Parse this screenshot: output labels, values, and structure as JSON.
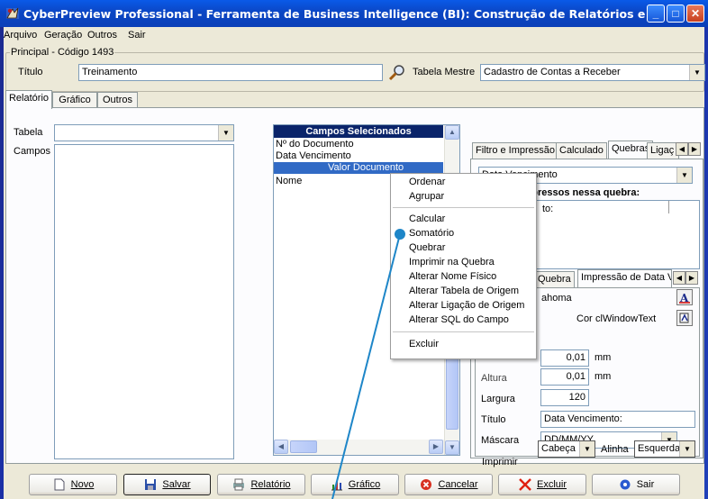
{
  "window": {
    "title": "CyberPreview Professional - Ferramenta de Business Intelligence (BI): Construção de Relatórios e Gráficos Per..."
  },
  "menu": [
    "Arquivo",
    "Geração",
    "Outros",
    "Sair"
  ],
  "principal": {
    "legend": "Principal - Código 1493",
    "titulo_label": "Título",
    "titulo_value": "Treinamento",
    "tabela_mestre_label": "Tabela Mestre",
    "tabela_mestre_value": "Cadastro de Contas a Receber"
  },
  "main_tabs": [
    "Relatório",
    "Gráfico",
    "Outros"
  ],
  "left_panel": {
    "tabela_label": "Tabela",
    "tabela_value": "",
    "campos_label": "Campos"
  },
  "selected_fields": {
    "header": "Campos Selecionados",
    "items": [
      "Nº do Documento",
      "Data Vencimento",
      "Valor Documento",
      "Nome"
    ],
    "selected_index": 2
  },
  "right_tabs": [
    "Filtro e Impressão",
    "Calculado",
    "Quebras",
    "Ligaç"
  ],
  "quebras": {
    "break_field": "Data Vencimento",
    "printed_label": "Campos impressos nessa quebra:",
    "printed_item_partial": "to:",
    "sub_tabs": [
      "Quebra",
      "Impressão de Data Ver"
    ],
    "font_name_partial": "ahoma",
    "cor_label": "Cor",
    "cor_value": "clWindowText",
    "pos_value_1": "0,01",
    "pos_unit_1": "mm",
    "altura_label": "Altura",
    "pos_value_2": "0,01",
    "pos_unit_2": "mm",
    "largura_label": "Largura",
    "largura_value": "120",
    "titulo_label": "Título",
    "titulo_value": "Data Vencimento:",
    "mascara_label": "Máscara",
    "mascara_value": "DD/MM/YY",
    "imprimir_label": "Imprimir",
    "imprimir_value": "Cabeça",
    "alinha_label": "Alinha",
    "alinha_value": "Esquerda"
  },
  "context_menu": {
    "groups": [
      [
        "Ordenar",
        "Agrupar"
      ],
      [
        "Calcular",
        "Somatório",
        "Quebrar",
        "Imprimir na Quebra",
        "Alterar Nome Físico",
        "Alterar Tabela de Origem",
        "Alterar Ligação de Origem",
        "Alterar SQL do Campo"
      ],
      [
        "Excluir"
      ]
    ]
  },
  "buttons": {
    "novo": "Novo",
    "salvar": "Salvar",
    "relatorio": "Relatório",
    "grafico": "Gráfico",
    "cancelar": "Cancelar",
    "excluir": "Excluir",
    "sair": "Sair"
  },
  "colors": {
    "titlebar": "#0a4fd6",
    "selection": "#316ac5",
    "pointer": "#1e86c8"
  }
}
